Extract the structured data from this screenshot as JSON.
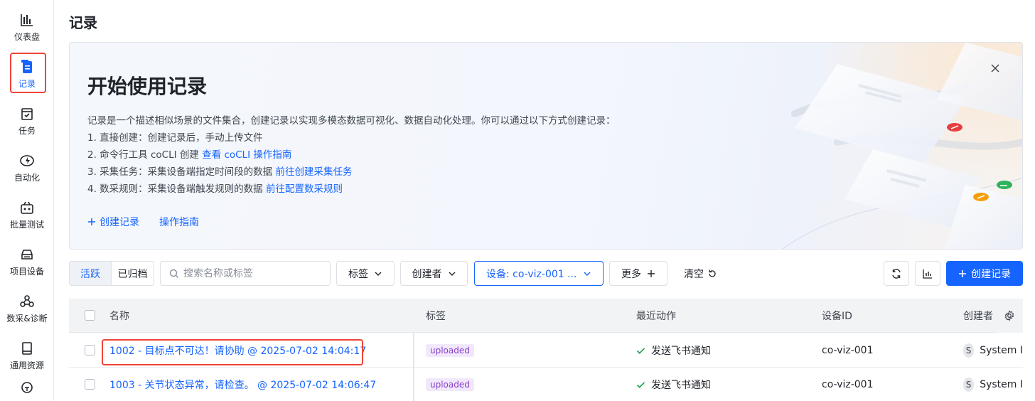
{
  "sidebar": {
    "items": [
      {
        "label": "仪表盘",
        "icon": "dashboard-icon"
      },
      {
        "label": "记录",
        "icon": "record-icon",
        "active": true
      },
      {
        "label": "任务",
        "icon": "task-icon"
      },
      {
        "label": "自动化",
        "icon": "automation-icon"
      },
      {
        "label": "批量测试",
        "icon": "batch-test-icon"
      },
      {
        "label": "项目设备",
        "icon": "device-icon"
      },
      {
        "label": "数采&诊断",
        "icon": "diagnosis-icon"
      },
      {
        "label": "通用资源",
        "icon": "resource-icon"
      }
    ]
  },
  "page": {
    "title": "记录"
  },
  "banner": {
    "title": "开始使用记录",
    "intro": "记录是一个描述相似场景的文件集合，创建记录以实现多模态数据可视化、数据自动化处理。你可以通过以下方式创建记录：",
    "line1": "1. 直接创建：创建记录后，手动上传文件",
    "line2_text": "2. 命令行工具 coCLI 创建 ",
    "line2_link": "查看 coCLI 操作指南",
    "line3_text": "3. 采集任务：采集设备端指定时间段的数据 ",
    "line3_link": "前往创建采集任务",
    "line4_text": "4. 数采规则：采集设备端触发规则的数据 ",
    "line4_link": "前往配置数采规则",
    "create_label": "创建记录",
    "guide_label": "操作指南"
  },
  "toolbar": {
    "tab_active": "活跃",
    "tab_archived": "已归档",
    "search_placeholder": "搜索名称或标签",
    "tags_label": "标签",
    "creator_label": "创建者",
    "device_label": "设备: co-viz-001 ...",
    "more_label": "更多",
    "clear_label": "清空",
    "create_label": "创建记录"
  },
  "table": {
    "headers": {
      "name": "名称",
      "tags": "标签",
      "action": "最近动作",
      "device": "设备ID",
      "creator": "创建者"
    },
    "rows": [
      {
        "name": "1002 - 目标点不可达！请协助 @ 2025-07-02 14:04:17",
        "tag": "uploaded",
        "action": "发送飞书通知",
        "device": "co-viz-001",
        "avatar": "S",
        "creator": "System I"
      },
      {
        "name": "1003 - 关节状态异常，请检查。 @ 2025-07-02 14:06:47",
        "tag": "uploaded",
        "action": "发送飞书通知",
        "device": "co-viz-001",
        "avatar": "S",
        "creator": "System I"
      }
    ]
  },
  "colors": {
    "accent": "#1664ff",
    "highlight": "#f04438",
    "tag_bg": "#f1e8fb",
    "tag_fg": "#8a3fc7",
    "success": "#16a34a"
  }
}
